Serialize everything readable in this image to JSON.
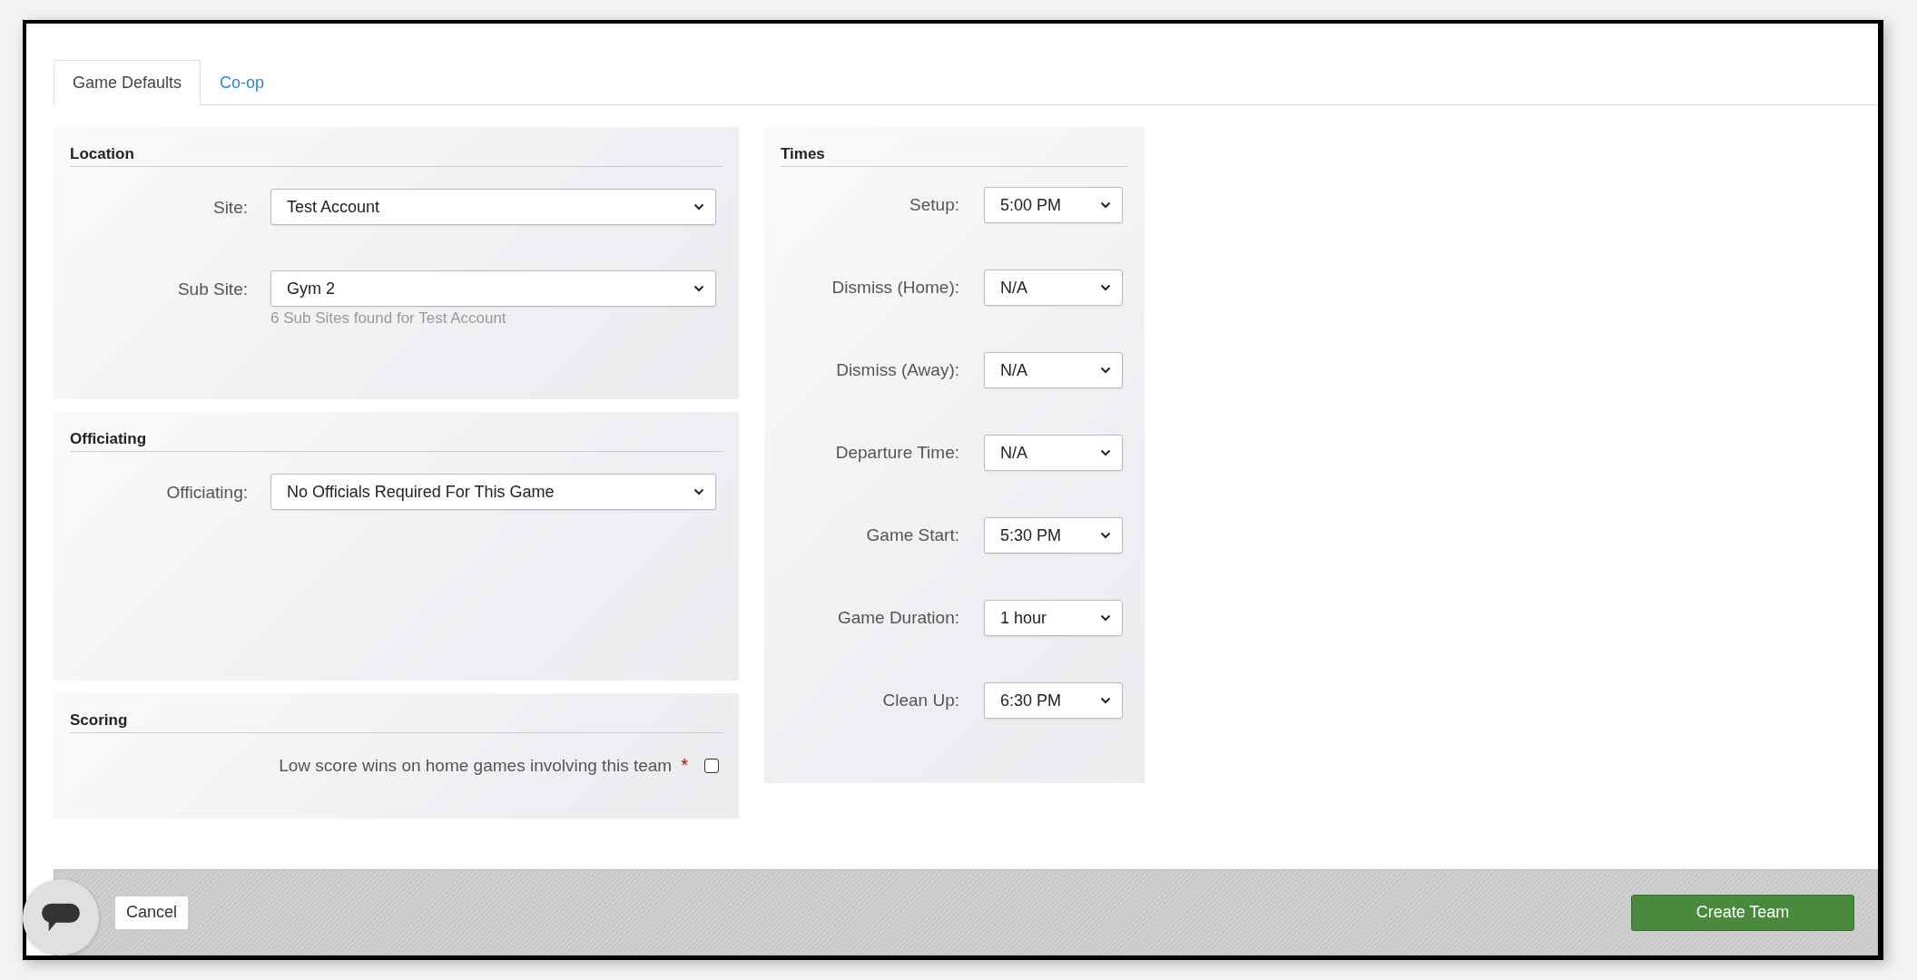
{
  "tabs": [
    {
      "label": "Game Defaults",
      "selected": true
    },
    {
      "label": "Co-op",
      "selected": false
    }
  ],
  "location": {
    "title": "Location",
    "fields": [
      {
        "label": "Site:",
        "value": "Test Account"
      },
      {
        "label": "Sub Site:",
        "value": "Gym 2",
        "hint": "6 Sub Sites found for Test Account"
      }
    ]
  },
  "officiating": {
    "title": "Officiating",
    "fields": [
      {
        "label": "Officiating:",
        "value": "No Officials Required For This Game"
      }
    ]
  },
  "scoring": {
    "title": "Scoring",
    "option": {
      "label": "Low score wins on home games involving this team",
      "required_mark": "*",
      "checked": false
    }
  },
  "times": {
    "title": "Times",
    "fields": [
      {
        "label": "Setup:",
        "value": "5:00 PM"
      },
      {
        "label": "Dismiss (Home):",
        "value": "N/A"
      },
      {
        "label": "Dismiss (Away):",
        "value": "N/A"
      },
      {
        "label": "Departure Time:",
        "value": "N/A"
      },
      {
        "label": "Game Start:",
        "value": "5:30 PM"
      },
      {
        "label": "Game Duration:",
        "value": "1 hour"
      },
      {
        "label": "Clean Up:",
        "value": "6:30 PM"
      }
    ]
  },
  "footer": {
    "cancel": "Cancel",
    "submit": "Create Team"
  }
}
